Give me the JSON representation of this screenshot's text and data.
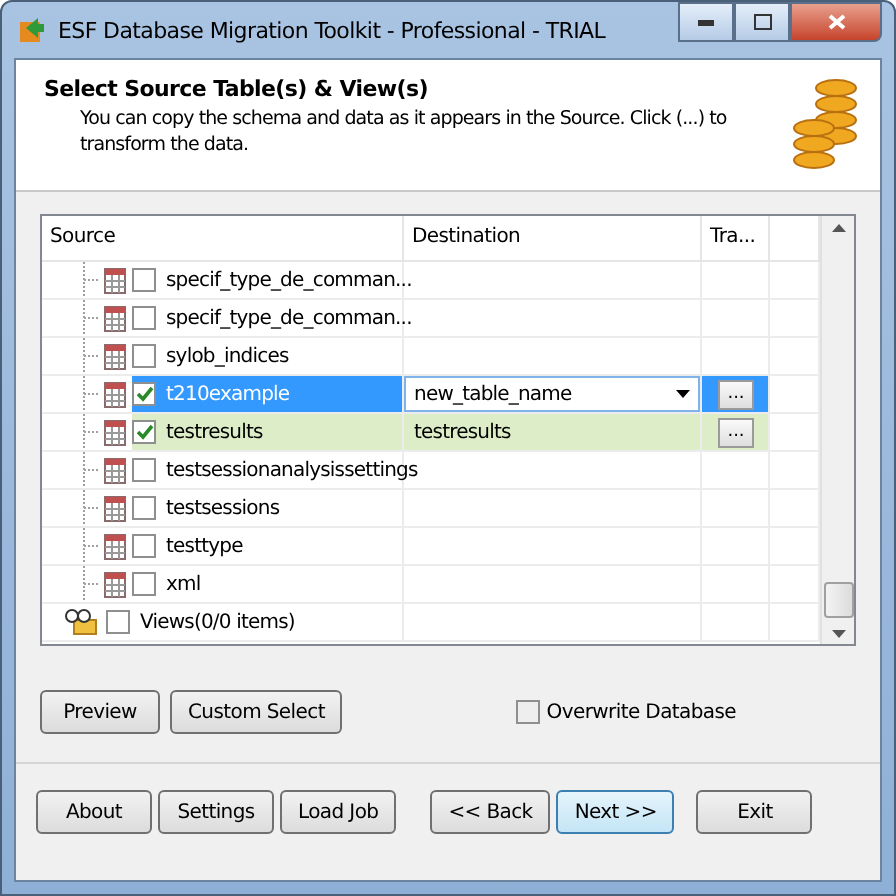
{
  "window": {
    "title": "ESF Database Migration Toolkit - Professional - TRIAL"
  },
  "header": {
    "title": "Select Source Table(s) & View(s)",
    "description": "You can copy the schema and data as it appears in the Source. Click (...) to transform the data."
  },
  "grid": {
    "columns": [
      "Source",
      "Destination",
      "Tra..."
    ],
    "rows": [
      {
        "kind": "table",
        "name": "specif_type_de_comman...",
        "checked": false,
        "selected": false
      },
      {
        "kind": "table",
        "name": "specif_type_de_comman...",
        "checked": false,
        "selected": false
      },
      {
        "kind": "table",
        "name": "sylob_indices",
        "checked": false,
        "selected": false
      },
      {
        "kind": "table",
        "name": "t210example",
        "checked": true,
        "selected": true,
        "destination": "new_table_name",
        "transform": "..."
      },
      {
        "kind": "table",
        "name": "testresults",
        "checked": true,
        "selected": false,
        "destination": "testresults",
        "transform": "..."
      },
      {
        "kind": "table",
        "name": "testsessionanalysissettings",
        "checked": false,
        "selected": false
      },
      {
        "kind": "table",
        "name": "testsessions",
        "checked": false,
        "selected": false
      },
      {
        "kind": "table",
        "name": "testtype",
        "checked": false,
        "selected": false
      },
      {
        "kind": "table",
        "name": "xml",
        "checked": false,
        "selected": false
      },
      {
        "kind": "views",
        "name": "Views(0/0 items)",
        "checked": false,
        "selected": false
      }
    ]
  },
  "actions": [
    "Preview",
    "Custom Select"
  ],
  "overwrite": {
    "label": "Overwrite Database",
    "checked": false
  },
  "footer": [
    {
      "label": "About",
      "default": false
    },
    {
      "label": "Settings",
      "default": false
    },
    {
      "label": "Load Job",
      "default": false
    },
    {
      "label": "<< Back",
      "default": false
    },
    {
      "label": "Next >>",
      "default": true
    },
    {
      "label": "Exit",
      "default": false
    }
  ]
}
